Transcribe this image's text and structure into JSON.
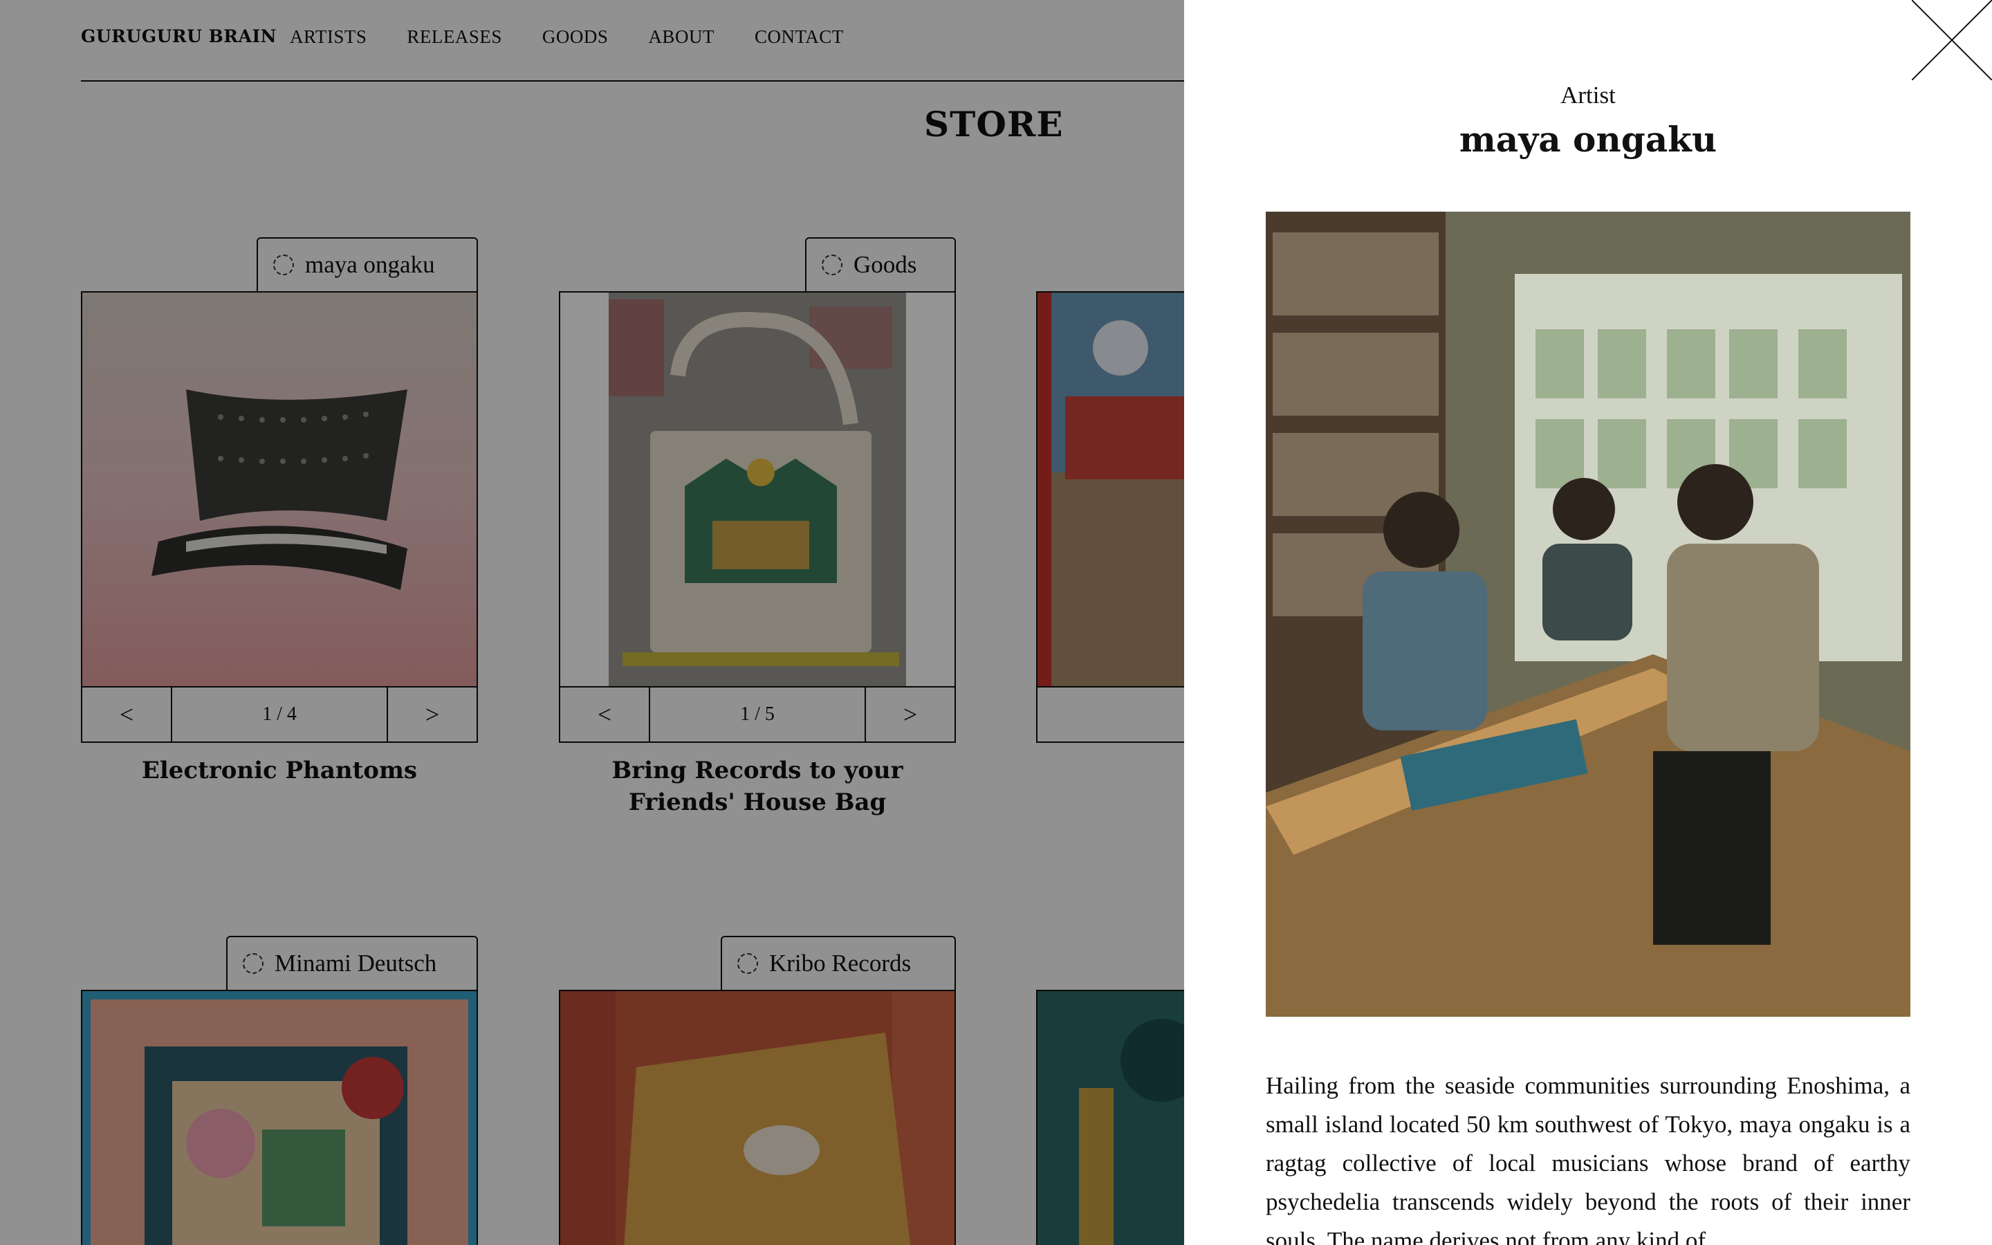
{
  "nav": {
    "brand": "GURUGURU BRAIN",
    "links": [
      "ARTISTS",
      "RELEASES",
      "GOODS",
      "ABOUT",
      "CONTACT"
    ]
  },
  "store": {
    "title": "STORE"
  },
  "cards": [
    {
      "tag": "maya ongaku",
      "page": "1 / 4",
      "title": "Electronic Phantoms",
      "image": "synthesizer-artwork"
    },
    {
      "tag": "Goods",
      "page": "1 / 5",
      "title": "Bring Records to your Friends' House Bag",
      "image": "tote-bag-photo"
    },
    {
      "tag": "",
      "page": "",
      "title": "",
      "image": "album-cover-partial"
    },
    {
      "tag": "Minami Deutsch",
      "image": "fortune-goodies-cover"
    },
    {
      "tag": "Kribo Records",
      "image": "fabric-pouch-photo"
    },
    {
      "tag": "",
      "image": "album-cover-partial-2"
    }
  ],
  "pager": {
    "prev": "<",
    "next": ">"
  },
  "panel": {
    "kicker": "Artist",
    "title": "maya ongaku",
    "photo": "band-members-at-record-table",
    "body": "Hailing from the seaside communities surrounding Enoshima, a small island located 50 km southwest of Tokyo, maya ongaku is a ragtag collective of local musicians whose brand of earthy psychedelia transcends widely beyond the roots of their inner souls. The name derives not from any kind of"
  },
  "icons": {
    "close": "close-icon",
    "tag": "circle-icon"
  }
}
